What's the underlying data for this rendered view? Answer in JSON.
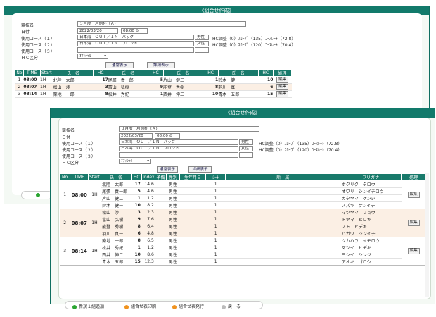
{
  "window_title": "《組合せ作成》",
  "form": {
    "tournament_label": "競技名",
    "tournament_value": "３月度　月例杯（Ａ）",
    "date_label": "日付",
    "date_value": "2022/03/20",
    "time_value": "08:00",
    "course1_label": "使用コース（１）",
    "course1_value": "日本海　ＯＵＴ／ＩＮ　バック",
    "course2_label": "使用コース（２）",
    "course2_value": "日本海　ＯＵＴ／ＩＮ　フロント",
    "course3_label": "使用コース（３）",
    "hc_label": "ＨＣ区分",
    "hc_select": "ｵﾌｨｼｬﾙ",
    "gender1": "男性",
    "gender2": "女性",
    "hc_adj1": "HC調整（0）ｽﾛｰﾌﾟ（135）ｺｰｽﾚｰﾄ（72.8）",
    "hc_adj2": "HC調整（0）ｽﾛｰﾌﾟ（120）ｺｰｽﾚｰﾄ（70.4）",
    "normal_btn": "通常表示",
    "detail_btn": "詳細表示"
  },
  "back_table": {
    "headers": [
      "No",
      "TIME",
      "Start",
      "氏　名",
      "HC",
      "氏　名",
      "HC",
      "氏　名",
      "HC",
      "氏　名",
      "HC",
      "処理"
    ],
    "rows": [
      {
        "no": "1",
        "time": "08:00",
        "start": "1H",
        "n1": "北陸　太郎",
        "h1": "17",
        "n2": "尾張　貢一郎",
        "h2": "5",
        "n3": "片山　健二",
        "h3": "1",
        "n4": "鈴木　健一",
        "h4": "10",
        "action": "編集"
      },
      {
        "no": "2",
        "time": "08:07",
        "start": "1H",
        "n1": "松山　渉",
        "h1": "3",
        "n2": "富山　弘樹",
        "h2": "9",
        "n3": "能登　秀樹",
        "h3": "8",
        "n4": "羽川　真一",
        "h4": "6",
        "action": "編集"
      },
      {
        "no": "3",
        "time": "08:14",
        "start": "1H",
        "n1": "築地　一郎",
        "h1": "8",
        "n2": "松井　秀紀",
        "h2": "1",
        "n3": "西井　伸二",
        "h3": "10",
        "n4": "青木　五郎",
        "h4": "15",
        "action": "編集"
      }
    ]
  },
  "front_table": {
    "headers": [
      "No",
      "TIME",
      "Start",
      "氏　名",
      "HC",
      "Index",
      "予備",
      "性別",
      "生年月日",
      "ｼｰﾄ",
      "所　属",
      "フリガナ",
      "処理"
    ],
    "groups": [
      {
        "no": "1",
        "time": "08:00",
        "start": "1H",
        "action": "編集",
        "players": [
          {
            "name": "北陸　太郎",
            "hc": "17",
            "index": "14.6",
            "gender": "男性",
            "seat": "1",
            "kana": "ホクリク　タロウ"
          },
          {
            "name": "尾張　貢一郎",
            "hc": "5",
            "index": "4.6",
            "gender": "男性",
            "seat": "1",
            "kana": "オワリ　シンイチロウ"
          },
          {
            "name": "片山　健二",
            "hc": "1",
            "index": "1.2",
            "gender": "男性",
            "seat": "1",
            "kana": "カタヤマ　ケンジ"
          },
          {
            "name": "鈴木　健一",
            "hc": "10",
            "index": "8.2",
            "gender": "男性",
            "seat": "1",
            "kana": "スズキ　ケンイチ"
          }
        ]
      },
      {
        "no": "2",
        "time": "08:07",
        "start": "1H",
        "action": "編集",
        "players": [
          {
            "name": "松山　渉",
            "hc": "3",
            "index": "2.3",
            "gender": "男性",
            "seat": "1",
            "kana": "マツヤマ　リョウ"
          },
          {
            "name": "富山　弘樹",
            "hc": "9",
            "index": "7.6",
            "gender": "男性",
            "seat": "1",
            "kana": "トヤマ　ヒロキ"
          },
          {
            "name": "能登　秀樹",
            "hc": "8",
            "index": "6.4",
            "gender": "男性",
            "seat": "1",
            "kana": "ノト　ヒデキ"
          },
          {
            "name": "羽川　真一",
            "hc": "6",
            "index": "4.8",
            "gender": "男性",
            "seat": "1",
            "kana": "ハガワ　シンイチ"
          }
        ]
      },
      {
        "no": "3",
        "time": "08:14",
        "start": "1H",
        "action": "編集",
        "players": [
          {
            "name": "築地　一郎",
            "hc": "8",
            "index": "6.5",
            "gender": "男性",
            "seat": "1",
            "kana": "ツカハラ　イチロウ"
          },
          {
            "name": "松井　秀紀",
            "hc": "1",
            "index": "1.2",
            "gender": "男性",
            "seat": "1",
            "kana": "マツイ　ヒデキ"
          },
          {
            "name": "西井　伸二",
            "hc": "10",
            "index": "8.6",
            "gender": "男性",
            "seat": "1",
            "kana": "ヨシイ　シンジ"
          },
          {
            "name": "青木　五郎",
            "hc": "15",
            "index": "12.3",
            "gender": "男性",
            "seat": "1",
            "kana": "アオキ　ゴロウ"
          }
        ]
      }
    ]
  },
  "status_bar": {
    "item1": "新規１組追加",
    "item2": "組合せ表印刷",
    "item3": "組合せ表発行",
    "item4": "戻　る",
    "colors": {
      "green": "#2aa531",
      "orange": "#f0921e",
      "gray": "#bbbbbb"
    }
  }
}
